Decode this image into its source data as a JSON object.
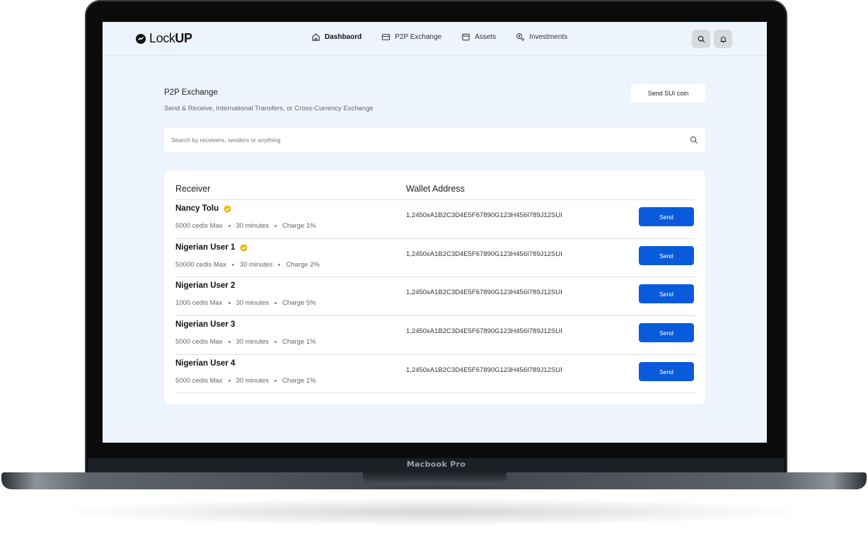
{
  "device": {
    "label": "Macbook Pro"
  },
  "header": {
    "logo_prefix": "Lock",
    "logo_suffix": "UP",
    "nav": [
      {
        "label": "Dashbaord",
        "icon": "home-icon",
        "active": true
      },
      {
        "label": "P2P Exchange",
        "icon": "card-icon",
        "active": false
      },
      {
        "label": "Assets",
        "icon": "wallet-icon",
        "active": false
      },
      {
        "label": "Investments",
        "icon": "coin-hand-icon",
        "active": false
      }
    ],
    "actions": [
      "search-icon",
      "bell-icon"
    ]
  },
  "page": {
    "title": "P2P Exchange",
    "subtitle": "Send & Receive, International Transfers, or Cross-Currency Exchange",
    "send_sui_label": "Send SUI coin"
  },
  "search": {
    "placeholder": "Search by receivers, senders or anything"
  },
  "table": {
    "headers": {
      "receiver": "Receiver",
      "wallet": "Wallet Address"
    },
    "rows": [
      {
        "name": "Nancy Tolu",
        "verified": true,
        "max": "5000 cedis Max",
        "time": "30 minutes",
        "charge": "Charge 1%",
        "wallet": "1,2450xA1B2C3D4E5F67890G123H456I789J12SUI",
        "action": "Send"
      },
      {
        "name": "Nigerian User 1",
        "verified": true,
        "max": "50000 cedis Max",
        "time": "30 minutes",
        "charge": "Charge 2%",
        "wallet": "1,2450xA1B2C3D4E5F67890G123H456I789J12SUI",
        "action": "Send"
      },
      {
        "name": "Nigerian User 2",
        "verified": false,
        "max": "1000 cedis Max",
        "time": "30 minutes",
        "charge": "Charge 5%",
        "wallet": "1,2450xA1B2C3D4E5F67890G123H456I789J12SUI",
        "action": "Send"
      },
      {
        "name": "Nigerian User 3",
        "verified": false,
        "max": "5000 cedis Max",
        "time": "30 minutes",
        "charge": "Charge 1%",
        "wallet": "1,2450xA1B2C3D4E5F67890G123H456I789J12SUI",
        "action": "Send"
      },
      {
        "name": "Nigerian User 4",
        "verified": false,
        "max": "5000 cedis Max",
        "time": "30 minutes",
        "charge": "Charge 1%",
        "wallet": "1,2450xA1B2C3D4E5F67890G123H456I789J12SUI",
        "action": "Send"
      }
    ]
  },
  "colors": {
    "primary": "#0a5bdc",
    "verified": "#f2b90f",
    "background": "#eef4fd"
  }
}
